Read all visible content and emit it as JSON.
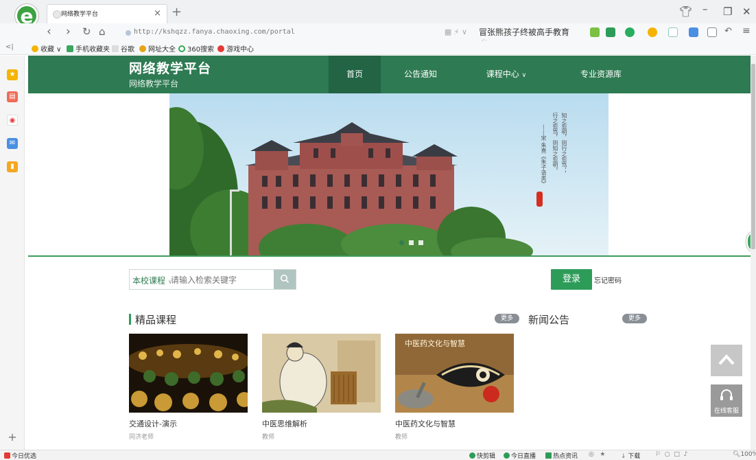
{
  "browser": {
    "logo_letter": "e",
    "tab_title": "网络教学平台",
    "tab_close": "×",
    "new_tab": "+",
    "url": "http://kshqzz.fanya.chaoxing.com/portal",
    "search_query": "冒张熊孩子终被高手教育",
    "bookmarks": [
      "收藏",
      "手机收藏夹",
      "谷歌",
      "网址大全",
      "360搜索",
      "游戏中心"
    ],
    "statusbar": {
      "left": "今日优选",
      "items": [
        "快剪辑",
        "今日直播",
        "热点资讯",
        "下载"
      ],
      "zoom": "100%"
    }
  },
  "site": {
    "title": "网络教学平台",
    "subtitle": "网络教学平台",
    "nav": [
      "首页",
      "公告通知",
      "课程中心",
      "专业资源库"
    ],
    "banner": {
      "poem_lines": [
        "知之愈明，则行之愈笃；",
        "行之愈笃，则知之愈明。",
        "——宋·朱熹《朱子语类》"
      ]
    },
    "search": {
      "scope": "本校课程",
      "placeholder": "请输入检索关键字"
    },
    "login_label": "登录",
    "forgot_label": "忘记密码",
    "featured": {
      "heading": "精品课程",
      "more": "更多",
      "courses": [
        {
          "name": "交通设计-演示",
          "teacher": "同济老师"
        },
        {
          "name": "中医思维解析",
          "teacher": "教师"
        },
        {
          "name": "中医药文化与智慧",
          "teacher": "教师"
        }
      ]
    },
    "news": {
      "heading": "新闻公告",
      "more": "更多"
    },
    "course3_banner_text": "中医药文化与智慧",
    "customer_service": "在线客服"
  }
}
